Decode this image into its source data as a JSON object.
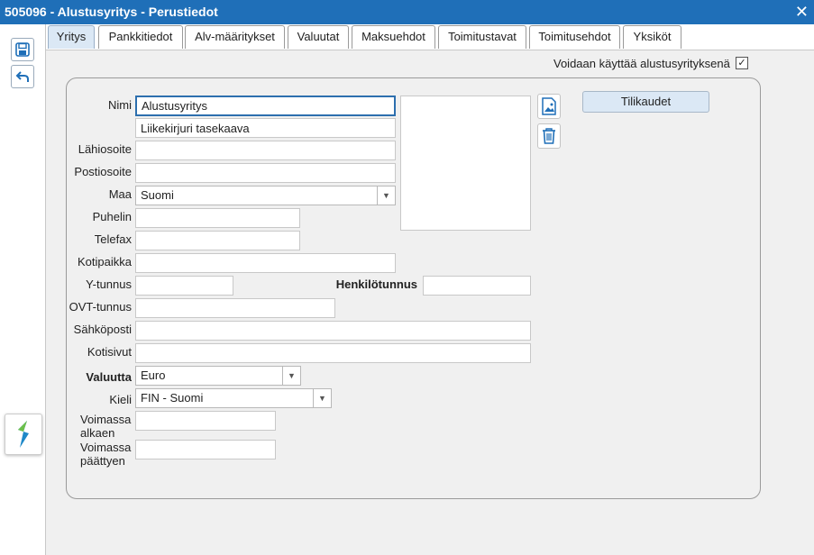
{
  "window": {
    "title": "505096 - Alustusyritys - Perustiedot",
    "close": "✕"
  },
  "toolbar": {
    "save": "save-icon",
    "back": "undo-icon",
    "logo": "app-logo"
  },
  "tabs": [
    {
      "label": "Yritys",
      "active": true
    },
    {
      "label": "Pankkitiedot"
    },
    {
      "label": "Alv-määritykset"
    },
    {
      "label": "Valuutat"
    },
    {
      "label": "Maksuehdot"
    },
    {
      "label": "Toimitustavat"
    },
    {
      "label": "Toimitusehdot"
    },
    {
      "label": "Yksiköt"
    }
  ],
  "template_check": {
    "label": "Voidaan käyttää alustusyrityksenä",
    "checked": true,
    "mark": "✓"
  },
  "form": {
    "name": {
      "label": "Nimi",
      "value": "Alustusyritys",
      "value2": "Liikekirjuri tasekaava"
    },
    "street": {
      "label": "Lähiosoite",
      "value": ""
    },
    "postal": {
      "label": "Postiosoite",
      "value": ""
    },
    "country": {
      "label": "Maa",
      "value": "Suomi"
    },
    "phone": {
      "label": "Puhelin",
      "value": ""
    },
    "fax": {
      "label": "Telefax",
      "value": ""
    },
    "domicile": {
      "label": "Kotipaikka",
      "value": ""
    },
    "business_id": {
      "label": "Y-tunnus",
      "value": ""
    },
    "personal_id": {
      "label": "Henkilötunnus",
      "value": ""
    },
    "ovt": {
      "label": "OVT-tunnus",
      "value": ""
    },
    "email": {
      "label": "Sähköposti",
      "value": ""
    },
    "website": {
      "label": "Kotisivut",
      "value": ""
    },
    "currency": {
      "label": "Valuutta",
      "value": "Euro"
    },
    "language": {
      "label": "Kieli",
      "value": "FIN - Suomi"
    },
    "valid_from": {
      "label_line1": "Voimassa",
      "label_line2": "alkaen",
      "value": ""
    },
    "valid_to": {
      "label_line1": "Voimassa",
      "label_line2": "päättyen",
      "value": ""
    }
  },
  "buttons": {
    "fiscal_periods": "Tilikaudet"
  }
}
